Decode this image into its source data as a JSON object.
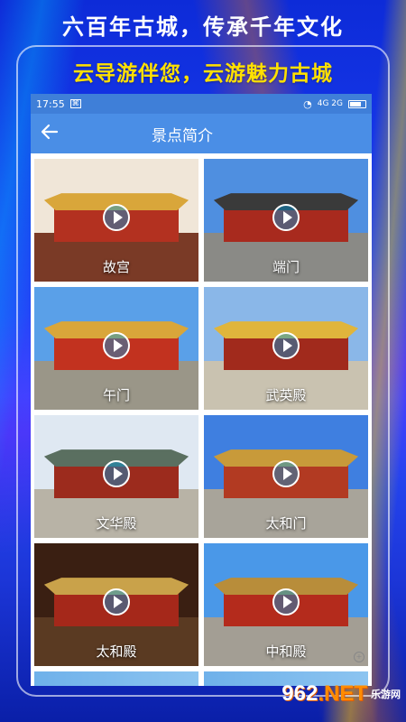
{
  "promo": {
    "title": "六百年古城，传承千年文化",
    "subtitle": "云导游伴您，云游魅力古城"
  },
  "status_bar": {
    "time": "17:55",
    "network": "4G 2G"
  },
  "app_bar": {
    "back_icon": "arrow-left-icon",
    "title": "景点简介"
  },
  "spots": [
    {
      "name": "故宫",
      "sky": "#f0e6d8",
      "ground": "#7a3a26",
      "wall": "#b33120",
      "roof": "#d9a63a"
    },
    {
      "name": "端门",
      "sky": "#4f8fe0",
      "ground": "#8a8a86",
      "wall": "#a82a1e",
      "roof": "#3a3a3a"
    },
    {
      "name": "午门",
      "sky": "#5aa0e8",
      "ground": "#9a9688",
      "wall": "#c2321f",
      "roof": "#d9a63a"
    },
    {
      "name": "武英殿",
      "sky": "#8ab7e8",
      "ground": "#c9c2b0",
      "wall": "#a12a1c",
      "roof": "#e0b53c"
    },
    {
      "name": "文华殿",
      "sky": "#dfe8f2",
      "ground": "#b8b3a6",
      "wall": "#9c2b1d",
      "roof": "#5a6f60"
    },
    {
      "name": "太和门",
      "sky": "#3f7fe0",
      "ground": "#a8a49a",
      "wall": "#b23a22",
      "roof": "#c89a3a"
    },
    {
      "name": "太和殿",
      "sky": "#3a1f12",
      "ground": "#5a3a22",
      "wall": "#a5281a",
      "roof": "#c9a24a"
    },
    {
      "name": "中和殿",
      "sky": "#4a98e8",
      "ground": "#a39e94",
      "wall": "#b42b1c",
      "roof": "#b88d3a"
    }
  ],
  "watermark": {
    "logo": "962",
    "logo_suffix": ".NET",
    "site": "乐游网"
  }
}
